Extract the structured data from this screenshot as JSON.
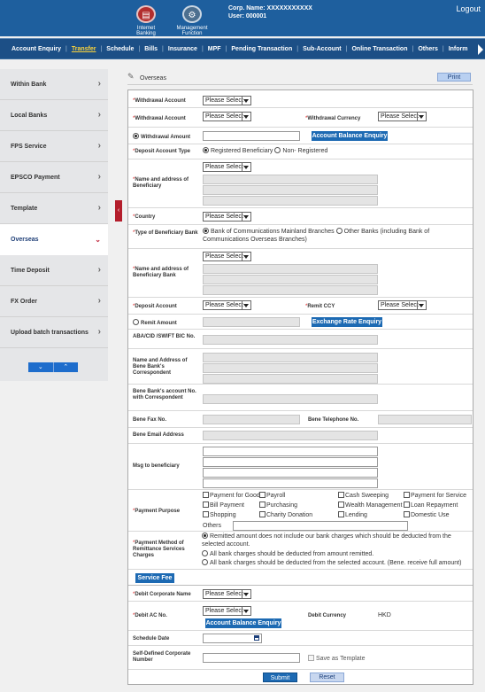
{
  "header": {
    "internet_banking": "Internet Banking",
    "management_function": "Management Function",
    "corp_name": "Corp. Name: XXXXXXXXXXX",
    "user": "User: 000001",
    "logout": "Logout"
  },
  "nav": {
    "items": [
      "Account Enquiry",
      "Transfer",
      "Schedule",
      "Bills",
      "Insurance",
      "MPF",
      "Pending Transaction",
      "Sub-Account",
      "Online Transaction",
      "Others",
      "Inform"
    ],
    "active_index": 1
  },
  "sidebar": {
    "items": [
      "Within Bank",
      "Local Banks",
      "FPS Service",
      "EPSCO Payment",
      "Template",
      "Overseas",
      "Time Deposit",
      "FX Order",
      "Upload batch transactions"
    ],
    "active_index": 5,
    "page_down": "⌄",
    "page_up": "⌃"
  },
  "page": {
    "title": "Overseas",
    "print": "Print"
  },
  "form": {
    "please_select": "Please Select",
    "withdrawal_account": "Withdrawal Account",
    "withdrawal_currency": "Withdrawal Currency",
    "withdrawal_amount": "Withdrawal Amount",
    "account_balance_enquiry": "Account Balance Enquiry",
    "deposit_account_type": "Deposit Account Type",
    "registered_beneficiary": "Registered Beneficiary",
    "non_registered": "Non- Registered",
    "name_address_beneficiary": "Name and address of Beneficiary",
    "country": "Country",
    "type_of_beneficiary_bank": "Type of Beneficiary Bank",
    "bocom_mainland": "Bank of Communications Mainland Branches",
    "other_banks": "Other Banks (including Bank of Communications Overseas Branches)",
    "name_address_beneficiary_bank": "Name and address of Beneficiary Bank",
    "deposit_account": "Deposit Account",
    "remit_ccy": "Remit CCY",
    "remit_amount": "Remit Amount",
    "exchange_rate_enquiry": "Exchange Rate Enquiry",
    "swift_bic": "ABA/CID /SWIFT BIC No.",
    "name_address_correspondent": "Name and Address of Bene Bank's Correspondent",
    "bene_bank_account_correspondent": "Bene Bank's account No. with Correspondent",
    "bene_fax": "Bene Fax No.",
    "bene_telephone": "Bene Telephone No.",
    "bene_email": "Bene Email Address",
    "msg_to_beneficiary": "Msg to beneficiary",
    "payment_purpose": "Payment Purpose",
    "purposes": [
      "Payment for Goods",
      "Payroll",
      "Cash Sweeping",
      "Payment for Service",
      "Bill Payment",
      "Purchasing",
      "Wealth Management",
      "Loan Repayment",
      "Shopping",
      "Charity Donation",
      "Lending",
      "Domestic Use"
    ],
    "others": "Others",
    "payment_method_label": "Payment Method of Remittance Services Charges",
    "payment_methods": [
      "Remitted amount does not include our bank charges which should be deducted from the selected account.",
      "All bank charges should be deducted from amount remitted.",
      "All bank charges should be deducted from the selected account. (Bene. receive full amount)"
    ],
    "service_fee": "Service Fee",
    "debit_corporate_name": "Debit Corporate Name",
    "debit_ac_no": "Debit AC No.",
    "debit_currency": "Debit Currency",
    "debit_currency_value": "HKD",
    "schedule_date": "Schedule Date",
    "self_defined_number": "Self-Defined Corporate Number",
    "save_as_template": "Save as Template",
    "submit": "Submit",
    "reset": "Reset"
  }
}
